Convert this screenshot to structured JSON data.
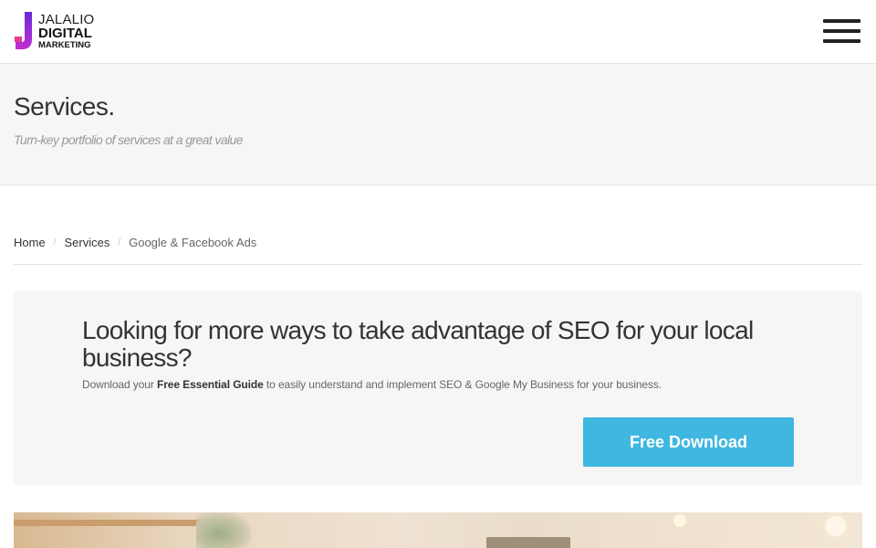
{
  "header": {
    "logo": {
      "line1": "JALALIO",
      "line2": "DIGITAL",
      "line3": "MARKETING",
      "mark_colors": [
        "#6a2bd9",
        "#e63a8c"
      ]
    },
    "menu_icon": "hamburger-menu-icon"
  },
  "page_title": {
    "title": "Services.",
    "subtitle": "Turn-key portfolio of services at a great value"
  },
  "breadcrumb": {
    "items": [
      {
        "label": "Home",
        "link": true
      },
      {
        "label": "Services",
        "link": true
      },
      {
        "label": "Google & Facebook Ads",
        "link": false
      }
    ],
    "separator": "/"
  },
  "cta": {
    "heading": "Looking for more ways to take advantage of SEO for your local business?",
    "text_before": "Download your ",
    "text_strong": "Free Essential Guide",
    "text_after": " to easily understand and implement SEO & Google My Business for your business.",
    "button_label": "Free Download",
    "button_color": "#3fb7e0"
  },
  "colors": {
    "title_band_bg": "#f6f6f6",
    "text_primary": "#333333",
    "text_muted": "#999999"
  }
}
